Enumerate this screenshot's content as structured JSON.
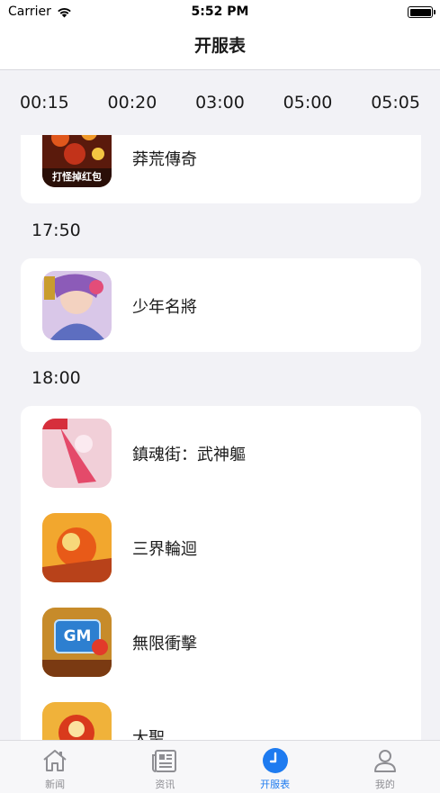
{
  "status_bar": {
    "carrier": "Carrier",
    "time": "5:52 PM"
  },
  "nav": {
    "title": "开服表"
  },
  "time_tabs": [
    "00:15",
    "00:20",
    "03:00",
    "05:00",
    "05:05"
  ],
  "sections": [
    {
      "time": "",
      "games": [
        {
          "name": "莽荒傳奇",
          "thumb_text": "打怪掉红包"
        }
      ]
    },
    {
      "time": "17:50",
      "games": [
        {
          "name": "少年名將",
          "thumb_text": ""
        }
      ]
    },
    {
      "time": "18:00",
      "games": [
        {
          "name": "鎮魂街：武神軀",
          "thumb_text": ""
        },
        {
          "name": "三界輪迴",
          "thumb_text": ""
        },
        {
          "name": "無限衝擊",
          "thumb_text": "GM"
        },
        {
          "name": "大聖",
          "thumb_text": ""
        }
      ]
    }
  ],
  "tab_bar": [
    {
      "label": "新闻",
      "icon": "home-icon"
    },
    {
      "label": "资讯",
      "icon": "news-icon"
    },
    {
      "label": "开服表",
      "icon": "clock-icon"
    },
    {
      "label": "我的",
      "icon": "user-icon"
    }
  ],
  "colors": {
    "accent": "#1e7bf0",
    "background": "#f2f2f6",
    "card": "#ffffff",
    "inactive": "#8e8e93"
  }
}
